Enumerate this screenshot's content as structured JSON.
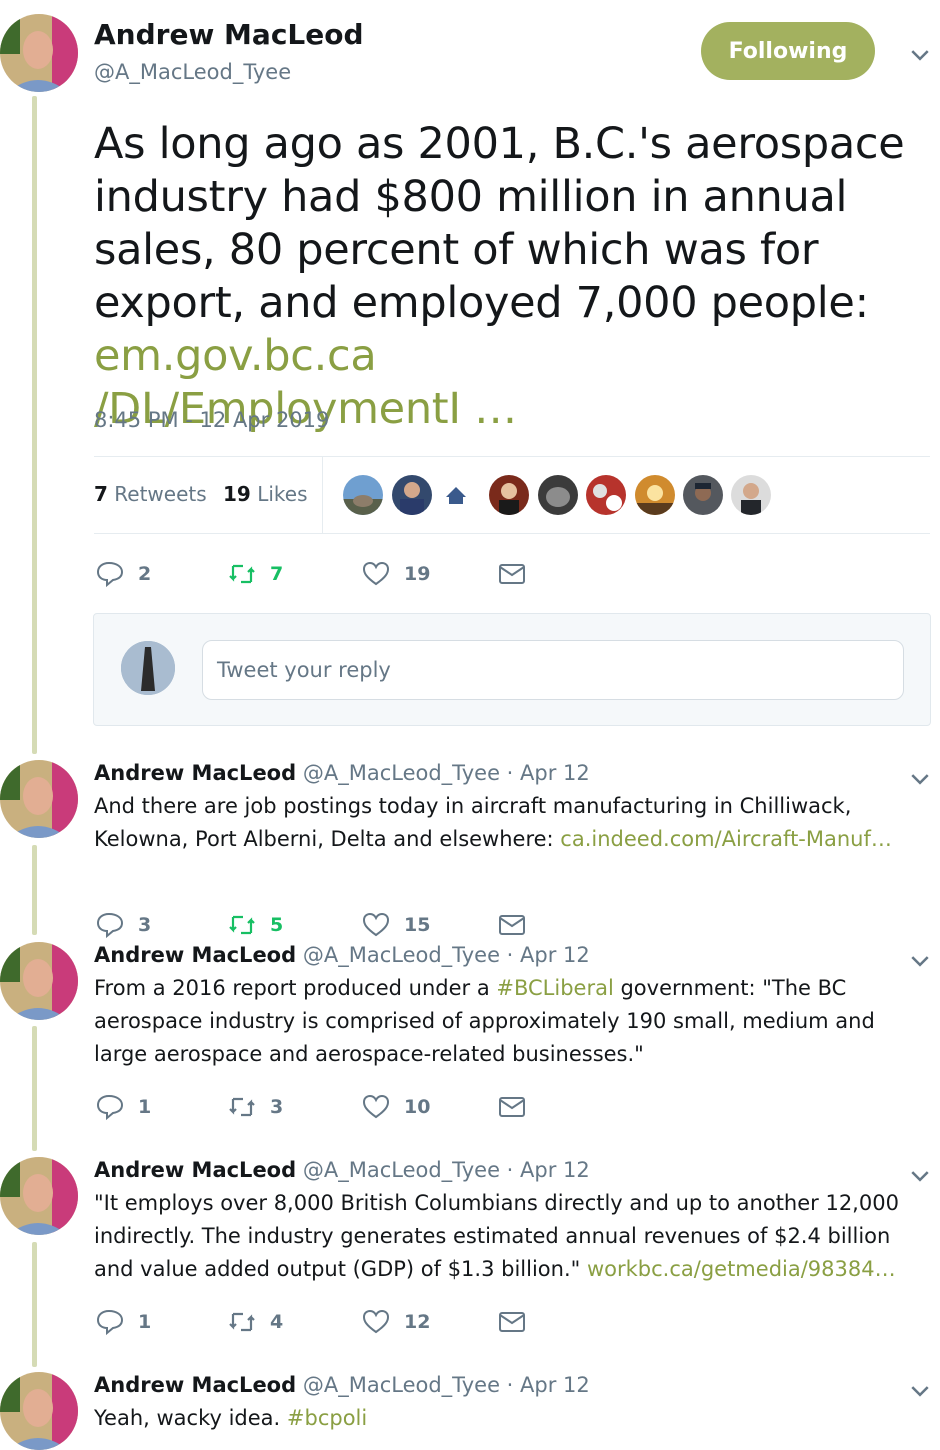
{
  "main_tweet": {
    "author_name": "Andrew MacLeod",
    "author_handle": "@A_MacLeod_Tyee",
    "follow_label": "Following",
    "text": "As long ago as 2001, B.C.'s aerospace industry had $800 million in annual sales, 80 percent of which was for export, and employed 7,000 people: ",
    "link_line1": "em.gov.bc.ca",
    "link_line2": "/DL/EmploymentI  …",
    "timestamp": "8:45 PM - 12 Apr 2019",
    "retweets_count": "7",
    "retweets_label": "Retweets",
    "likes_count": "19",
    "likes_label": "Likes",
    "actions": {
      "replies": "2",
      "retweets": "7",
      "likes": "19"
    },
    "reply_placeholder": "Tweet your reply"
  },
  "colors": {
    "accent": "#8a9f43",
    "follow_button": "#a3b15f",
    "thread_line": "#d5dbb5",
    "retweet_active": "#17bf63"
  },
  "replies": [
    {
      "author_name": "Andrew MacLeod",
      "meta": "@A_MacLeod_Tyee · Apr 12",
      "text_before": "And there are job postings today in aircraft manufacturing in Chilliwack, Kelowna, Port Alberni, Delta and elsewhere: ",
      "link": "ca.indeed.com/Aircraft-Manuf…",
      "text_after": "",
      "actions": {
        "replies": "3",
        "retweets": "5",
        "likes": "15"
      }
    },
    {
      "author_name": "Andrew MacLeod",
      "meta": "@A_MacLeod_Tyee · Apr 12",
      "text_before": "From a 2016 report produced under a ",
      "link": "#BCLiberal",
      "text_after": " government: \"The BC aerospace industry is comprised of approximately 190 small, medium and large aerospace and aerospace-related businesses.\"",
      "actions": {
        "replies": "1",
        "retweets": "3",
        "likes": "10"
      }
    },
    {
      "author_name": "Andrew MacLeod",
      "meta": "@A_MacLeod_Tyee · Apr 12",
      "text_before": "\"It employs over 8,000 British Columbians directly and up to another 12,000 indirectly. The industry generates estimated annual revenues of $2.4 billion and value added output (GDP) of $1.3 billion.\" ",
      "link": "workbc.ca/getmedia/98384…",
      "text_after": "",
      "actions": {
        "replies": "1",
        "retweets": "4",
        "likes": "12"
      }
    },
    {
      "author_name": "Andrew MacLeod",
      "meta": "@A_MacLeod_Tyee · Apr 12",
      "text_before": "Yeah, wacky idea. ",
      "link": "#bcpoli",
      "text_after": "",
      "actions": null
    }
  ]
}
